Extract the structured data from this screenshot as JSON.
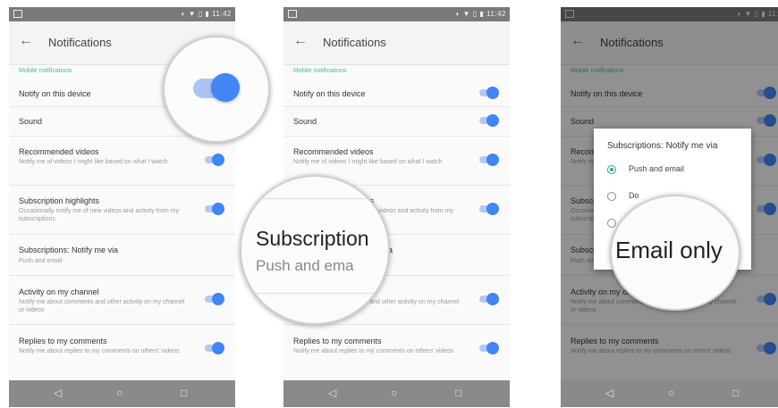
{
  "status_time": "11:42",
  "status_time_cut": "11:4",
  "appbar": {
    "title": "Notifications",
    "back_icon": "arrow-back-icon"
  },
  "section": "Mobile notifications",
  "rows": [
    {
      "title": "Notify on this device",
      "subtitle": "",
      "toggle": true
    },
    {
      "title": "Sound",
      "subtitle": "",
      "toggle": true
    },
    {
      "title": "Recommended videos",
      "subtitle": "Notify me of videos I might like based on what I watch",
      "toggle": true
    },
    {
      "title": "Subscription highlights",
      "subtitle": "Occasionally notify me of new videos and activity from my subscriptions",
      "toggle": true
    },
    {
      "title": "Subscriptions: Notify me via",
      "subtitle": "Push and email",
      "toggle": false
    },
    {
      "title": "Activity on my channel",
      "subtitle": "Notify me about comments and other activity on my channel or videos",
      "toggle": true
    },
    {
      "title": "Replies to my comments",
      "subtitle": "Notify me about replies to my comments on others' videos",
      "toggle": true
    }
  ],
  "magnifier2": {
    "line1": "Subscription",
    "line2": "Push and ema"
  },
  "dialog": {
    "title": "Subscriptions: Notify me via",
    "options": [
      {
        "label": "Push and email",
        "selected": true
      },
      {
        "label": "Do",
        "selected": false
      },
      {
        "label": "",
        "selected": false
      }
    ]
  },
  "magnifier3": {
    "text": "Email only"
  },
  "nav": {
    "back": "◁",
    "home": "○",
    "recents": "□"
  },
  "colors": {
    "accent": "#4285f4",
    "teal": "#26a69a",
    "overlay": "rgba(0,0,0,0.42)"
  }
}
